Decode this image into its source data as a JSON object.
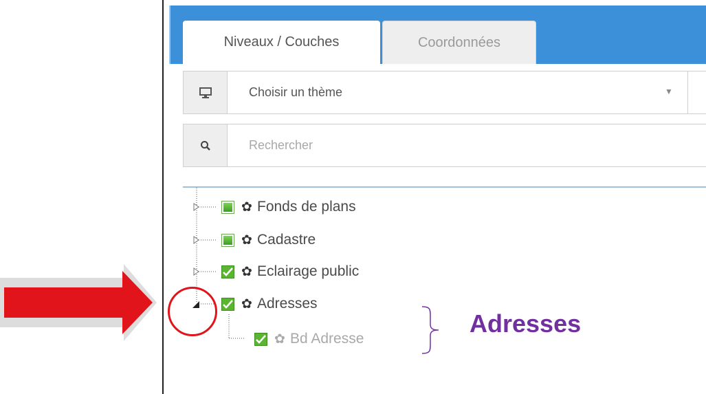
{
  "tabs": [
    {
      "label": "Niveaux / Couches",
      "active": true
    },
    {
      "label": "Coordonnées",
      "active": false
    }
  ],
  "theme_select": {
    "icon": "monitor-icon",
    "placeholder": "Choisir un thème",
    "caret": "▼"
  },
  "search": {
    "icon": "search-icon",
    "placeholder": "Rechercher"
  },
  "tree": {
    "items": [
      {
        "label": "Fonds de plans",
        "state": "partial",
        "expanded": false
      },
      {
        "label": "Cadastre",
        "state": "partial",
        "expanded": false
      },
      {
        "label": "Eclairage public",
        "state": "checked",
        "expanded": false
      },
      {
        "label": "Adresses",
        "state": "checked",
        "expanded": true,
        "children": [
          {
            "label": "Bd Adresse",
            "state": "checked",
            "disabled": true
          }
        ]
      }
    ]
  },
  "annotation": {
    "callout": "Adresses",
    "arrow_color": "#e0141a",
    "callout_color": "#7030a0"
  },
  "colors": {
    "header": "#3c8fd9",
    "checkbox_green": "#5cb531"
  }
}
